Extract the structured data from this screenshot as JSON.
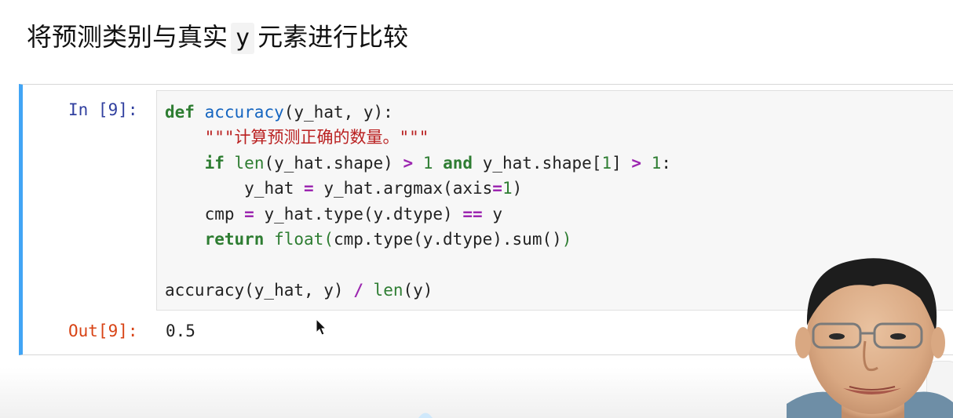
{
  "heading": {
    "prefix": "将预测类别与真实",
    "code": "y",
    "suffix": "元素进行比较"
  },
  "cell": {
    "in_prompt": "In [9]:",
    "out_prompt": "Out[9]:",
    "output_value": "0.5",
    "code_tokens": {
      "def": "def",
      "fn_name": "accuracy",
      "sig": "(y_hat, y):",
      "docstring": "\"\"\"计算预测正确的数量。\"\"\"",
      "if": "if",
      "len": "len",
      "cond1": "(y_hat.shape)",
      "gt": ">",
      "one": "1",
      "and": "and",
      "cond2": "y_hat.shape[",
      "cond3": "]",
      "colon": ":",
      "argmax_lhs": "y_hat",
      "eq": "=",
      "argmax_rhs": "y_hat.argmax(axis",
      "argmax_close": ")",
      "cmp_lhs": "cmp",
      "cmp_rhs": "y_hat.type(y.dtype)",
      "eqeq": "==",
      "y": "y",
      "return": "return",
      "float": "float",
      "paren_open": "(",
      "sum_expr": "cmp.type(y.dtype).sum()",
      "paren_close": ")",
      "call": "accuracy(y_hat, y)",
      "div": "/",
      "len_arg": "(y)"
    }
  },
  "colors": {
    "cell_border_accent": "#42a5f5",
    "in_prompt": "#303f9f",
    "out_prompt": "#d84315",
    "keyword": "#2e7d32",
    "function_name": "#1565c0",
    "operator": "#9c27b0",
    "string": "#ba2121"
  },
  "icons": {
    "cursor": "mouse-pointer-icon"
  }
}
